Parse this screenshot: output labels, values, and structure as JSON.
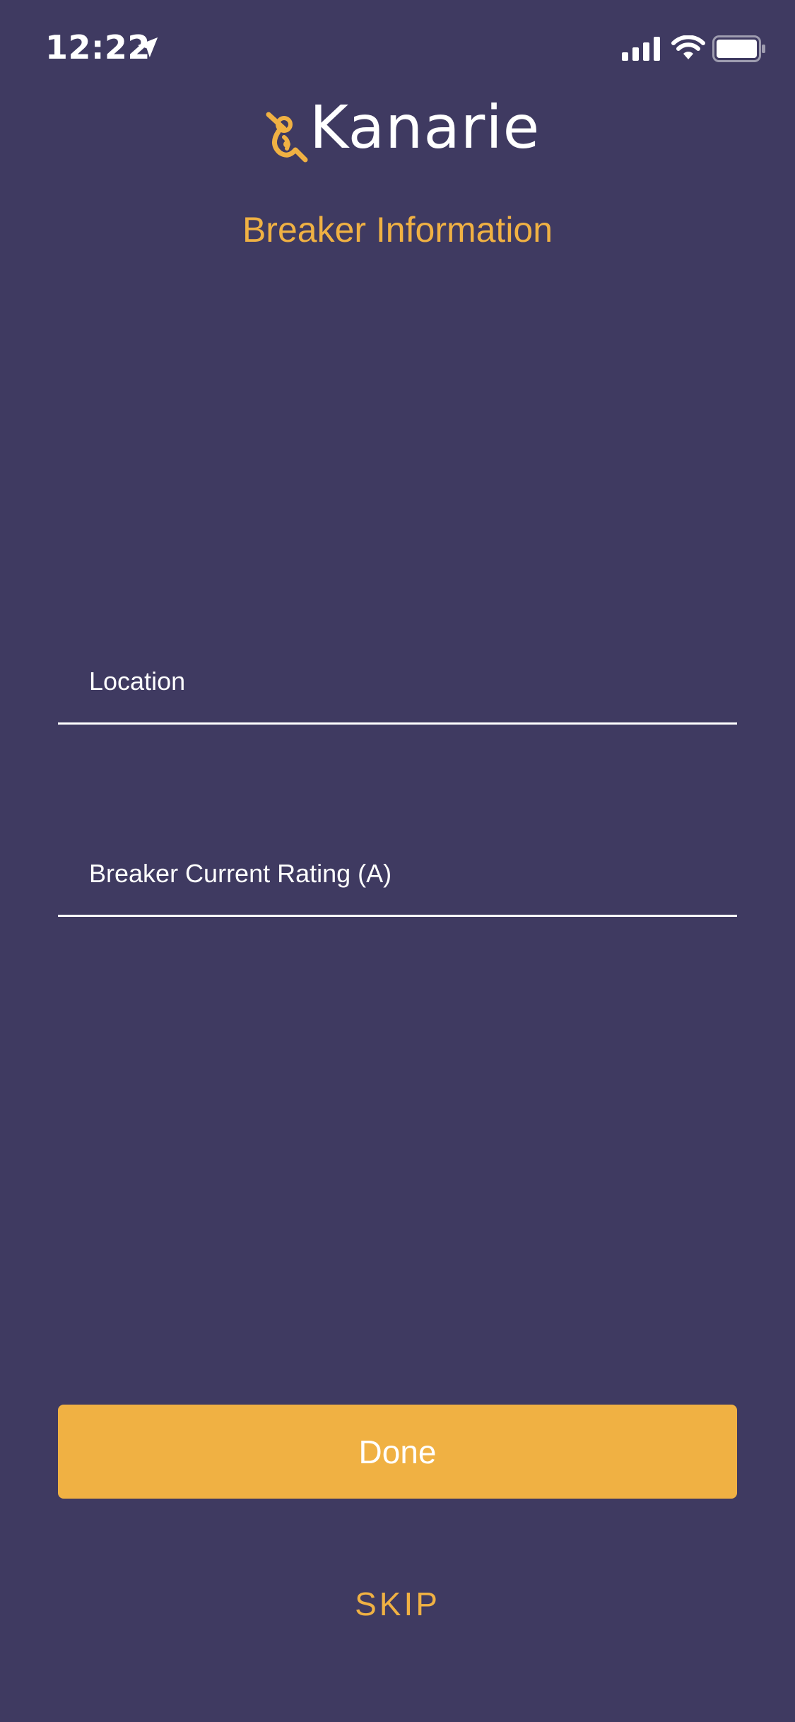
{
  "status_bar": {
    "time": "12:22"
  },
  "app": {
    "name": "Kanarie"
  },
  "page": {
    "title": "Breaker Information"
  },
  "form": {
    "location": {
      "placeholder": "Location",
      "value": ""
    },
    "rating": {
      "placeholder": "Breaker Current Rating (A)",
      "value": ""
    }
  },
  "actions": {
    "done_label": "Done",
    "skip_label": "SKIP"
  },
  "colors": {
    "background": "#3f3a61",
    "accent": "#f0b143",
    "text": "#ffffff"
  },
  "icons": {
    "location_arrow": "location-arrow-icon",
    "signal": "signal-icon",
    "wifi": "wifi-icon",
    "battery": "battery-icon",
    "logo": "bird-logo-icon"
  }
}
